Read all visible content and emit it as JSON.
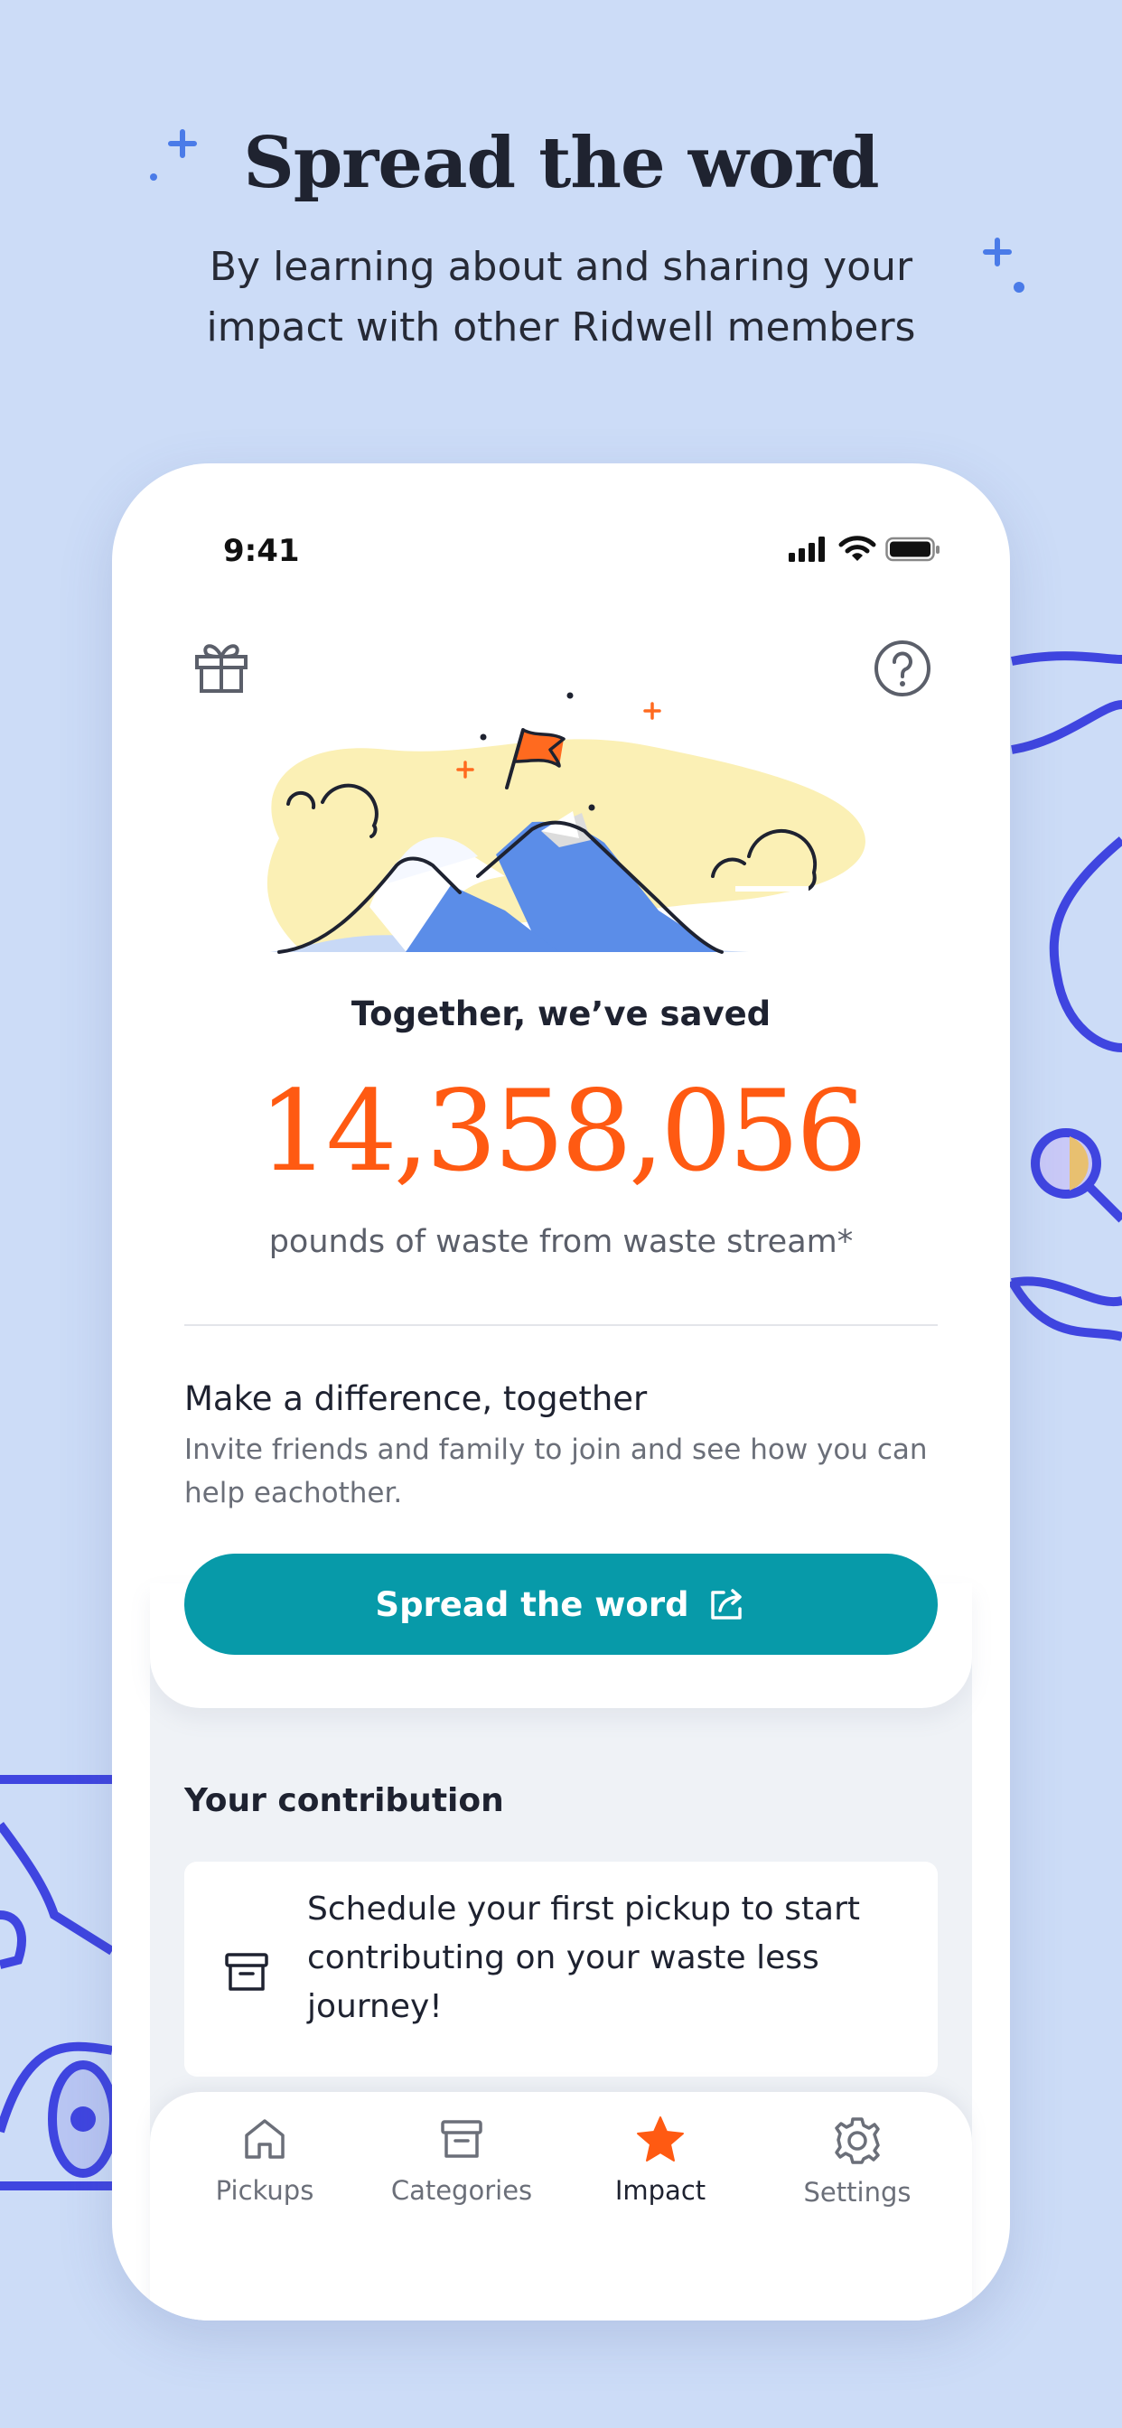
{
  "headline": "Spread the word",
  "subline": "By learning about and sharing your impact with other Ridwell members",
  "status": {
    "time": "9:41"
  },
  "impact": {
    "together_label": "Together, we’ve saved",
    "total": "14,358,056",
    "unit_label": "pounds of waste from waste stream*"
  },
  "share": {
    "title": "Make a difference, together",
    "text": "Invite friends and family to join and see how you can help eachother.",
    "button_label": "Spread the word"
  },
  "contribution": {
    "title": "Your contribution",
    "message": "Schedule your first pickup to start contributing on your waste less journey!"
  },
  "tabs": [
    {
      "label": "Pickups",
      "icon": "home-icon"
    },
    {
      "label": "Categories",
      "icon": "box-icon"
    },
    {
      "label": "Impact",
      "icon": "star-icon",
      "active": true
    },
    {
      "label": "Settings",
      "icon": "gear-icon"
    }
  ],
  "colors": {
    "background": "#ccdcf7",
    "accent_orange": "#ff5a12",
    "button_teal": "#079aa9",
    "decor_blue": "#3f45e0"
  }
}
